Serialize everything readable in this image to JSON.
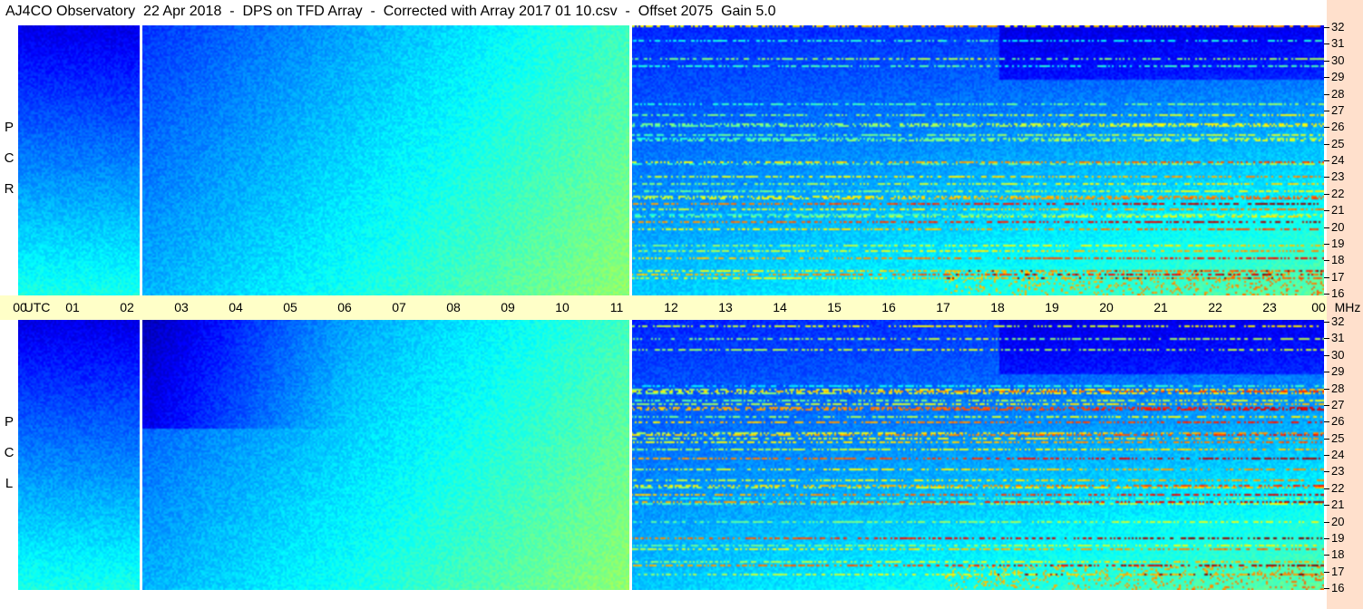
{
  "title": "AJ4CO Observatory  22 Apr 2018  -  DPS on TFD Array  -  Corrected with Array 2017 01 10.csv  -  Offset 2075  Gain 5.0",
  "panels": {
    "top_label": [
      "R",
      "C",
      "P"
    ],
    "bottom_label": [
      "L",
      "C",
      "P"
    ]
  },
  "chart_data": {
    "type": "heatmap",
    "title": "AJ4CO Observatory  22 Apr 2018  -  DPS on TFD Array  -  Corrected with Array 2017 01 10.csv  -  Offset 2075  Gain 5.0",
    "xlabel": "UTC",
    "ylabel": "MHz",
    "x_ticks": [
      "00",
      "01",
      "02",
      "03",
      "04",
      "05",
      "06",
      "07",
      "08",
      "09",
      "10",
      "11",
      "12",
      "13",
      "14",
      "15",
      "16",
      "17",
      "18",
      "19",
      "20",
      "21",
      "22",
      "23",
      "00"
    ],
    "x_range_hours": [
      0,
      24
    ],
    "y_ticks": [
      "16",
      "17",
      "18",
      "19",
      "20",
      "21",
      "22",
      "23",
      "24",
      "25",
      "26",
      "27",
      "28",
      "29",
      "30",
      "31",
      "32"
    ],
    "ylim": [
      16,
      32
    ],
    "series": [
      {
        "name": "RCP"
      },
      {
        "name": "LCP"
      }
    ],
    "data_gaps_hours": [
      2.25,
      11.25
    ]
  }
}
